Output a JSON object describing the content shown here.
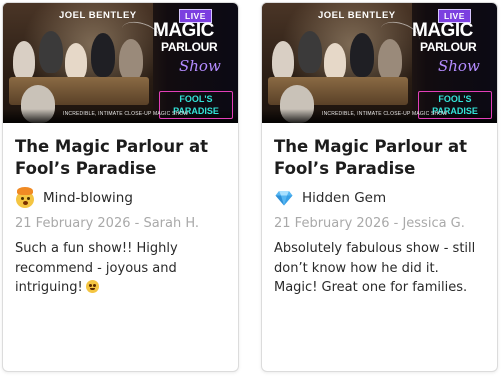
{
  "cards": [
    {
      "poster": {
        "performer": "JOEL BENTLEY",
        "live_badge": "LIVE",
        "magic": "MAGIC",
        "parlour": "PARLOUR",
        "show": "Show",
        "venue_line1": "FOOL'S",
        "venue_line2": "PARADISE",
        "tagline": "INCREDIBLE, INTIMATE CLOSE-UP MAGIC SHOW"
      },
      "title": "The Magic Parlour at Fool’s Paradise",
      "rating_icon": "mind-blown-emoji",
      "rating_label": "Mind-blowing",
      "meta": "21 February 2026 - Sarah H.",
      "review": "Such a fun show!! Highly recommend - joyous and intriguing!",
      "review_emoji": "star-struck-emoji"
    },
    {
      "poster": {
        "performer": "JOEL BENTLEY",
        "live_badge": "LIVE",
        "magic": "MAGIC",
        "parlour": "PARLOUR",
        "show": "Show",
        "venue_line1": "FOOL'S",
        "venue_line2": "PARADISE",
        "tagline": "INCREDIBLE, INTIMATE CLOSE-UP MAGIC SHOW"
      },
      "title": "The Magic Parlour at Fool’s Paradise",
      "rating_icon": "gem-emoji",
      "rating_label": "Hidden Gem",
      "meta": "21 February 2026 - Jessica G.",
      "review": "Absolutely fabulous show - still don’t know how he did it. Magic! Great one for families."
    }
  ],
  "colors": {
    "title": "#1c1c1c",
    "meta": "#a9a9a9",
    "live_badge": "#7b3fe0",
    "venue_border": "#e23fb8",
    "venue_text": "#33e3d8"
  }
}
